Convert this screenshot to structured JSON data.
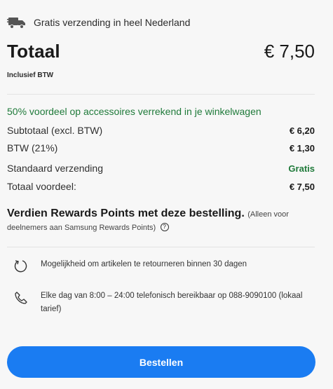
{
  "shipping": {
    "icon": "truck-icon",
    "text": "Gratis verzending in heel Nederland"
  },
  "total": {
    "label": "Totaal",
    "amount": "€ 7,50",
    "vat_note": "Inclusief BTW"
  },
  "promo": "50% voordeel op accessoires verrekend in je winkelwagen",
  "lines": [
    {
      "label": "Subtotaal (excl. BTW)",
      "value": "€ 6,20"
    },
    {
      "label": "BTW (21%)",
      "value": "€ 1,30"
    },
    {
      "label": "Standaard verzending",
      "value": "Gratis"
    },
    {
      "label": "Totaal voordeel:",
      "value": "€ 7,50"
    }
  ],
  "rewards": {
    "strong": "Verdien Rewards Points met deze bestelling.",
    "small": "(Alleen voor deelnemers aan Samsung Rewards Points)",
    "info_icon": "info-icon"
  },
  "features": [
    {
      "icon": "return-icon",
      "text": "Mogelijkheid om artikelen te retourneren binnen 30 dagen"
    },
    {
      "icon": "phone-icon",
      "text": "Elke dag van 8:00 – 24:00 telefonisch bereikbaar op 088-9090100 (lokaal tarief)"
    }
  ],
  "order_button": "Bestellen",
  "colors": {
    "accent": "#1a7cf2",
    "green": "#1f7a3a",
    "background": "#f7f7f7"
  }
}
